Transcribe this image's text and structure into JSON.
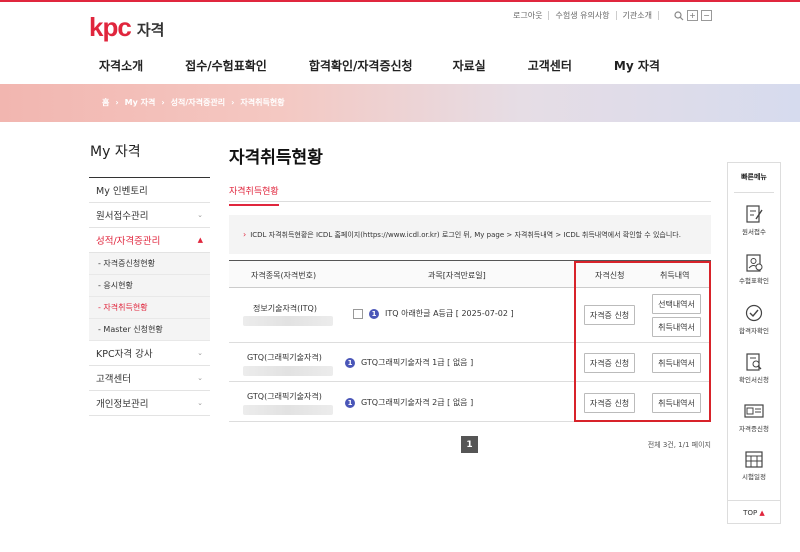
{
  "header": {
    "logo_mark": "kpc",
    "logo_text": "자격",
    "util": [
      "로그아웃",
      "수험생 유의사항",
      "기관소개"
    ],
    "gnb": [
      "자격소개",
      "접수/수험표확인",
      "합격확인/자격증신청",
      "자료실",
      "고객센터",
      "My 자격"
    ]
  },
  "breadcrumb": [
    "홈",
    "My 자격",
    "성적/자격증관리",
    "자격취득현황"
  ],
  "lnb": {
    "title": "My 자격",
    "items": [
      {
        "label": "My 인벤토리"
      },
      {
        "label": "원서접수관리"
      },
      {
        "label": "성적/자격증관리"
      },
      {
        "label": "KPC자격 강사"
      },
      {
        "label": "고객센터"
      },
      {
        "label": "개인정보관리"
      }
    ],
    "sub_items": [
      "- 자격증신청현황",
      "- 응시현황",
      "- 자격취득현황",
      "- Master 신청현황"
    ]
  },
  "main": {
    "title": "자격취득현황",
    "tab": "자격취득현황",
    "notice": "ICDL 자격취득현황은 ICDL 홈페이지(https://www.icdl.or.kr) 로그인 뒤, My page > 자격취득내역 > ICDL 취득내역에서 확인할 수 있습니다.",
    "notice_mark": "›",
    "columns": [
      "자격종목(자격번호)",
      "과목[자격만료일]",
      "자격신청",
      "취득내역"
    ],
    "rows": [
      {
        "category": "정보기술자격(ITQ)",
        "badge": "1",
        "subject": "ITQ 아래한글 A등급 [ 2025-07-02 ]",
        "apply": "자격증 신청",
        "history": [
          "선택내역서",
          "취득내역서"
        ]
      },
      {
        "category": "GTQ(그래픽기술자격)",
        "badge": "1",
        "subject": "GTQ그래픽기술자격 1급 [ 없음 ]",
        "apply": "자격증 신청",
        "history": [
          "취득내역서"
        ]
      },
      {
        "category": "GTQ(그래픽기술자격)",
        "badge": "1",
        "subject": "GTQ그래픽기술자격 2급 [ 없음 ]",
        "apply": "자격증 신청",
        "history": [
          "취득내역서"
        ]
      }
    ],
    "page": "1",
    "total": "전체 3건, 1/1 페이지"
  },
  "quick_menu": {
    "title": "빠른메뉴",
    "items": [
      "원서접수",
      "수험표확인",
      "합격자확인",
      "확인서신청",
      "자격증신청",
      "시험일정"
    ],
    "top": "TOP"
  },
  "colors": {
    "brand": "#e0263d",
    "badge": "#4a56b8",
    "highlight": "#d8232a"
  }
}
